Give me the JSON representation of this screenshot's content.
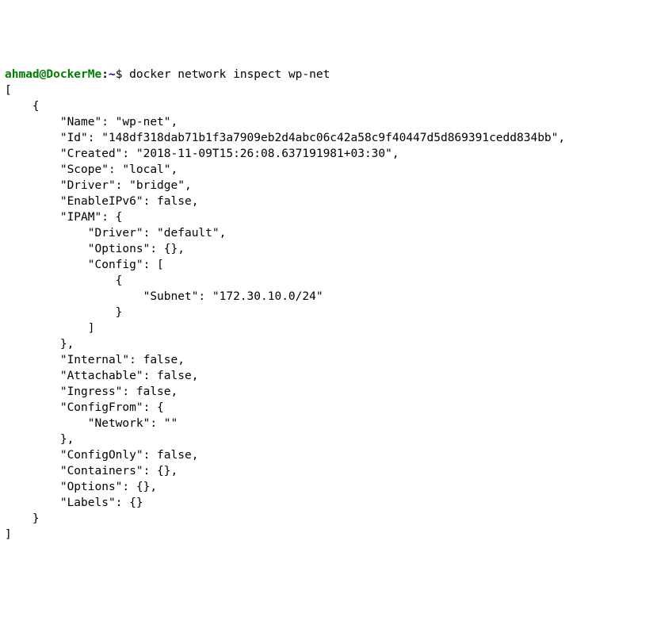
{
  "prompt": {
    "user": "ahmad",
    "at": "@",
    "host": "DockerMe",
    "colon": ":",
    "path": "~",
    "dollar": "$ "
  },
  "command": "docker network inspect wp-net",
  "output": "[\n    {\n        \"Name\": \"wp-net\",\n        \"Id\": \"148df318dab71b1f3a7909eb2d4abc06c42a58c9f40447d5d869391cedd834bb\",\n        \"Created\": \"2018-11-09T15:26:08.637191981+03:30\",\n        \"Scope\": \"local\",\n        \"Driver\": \"bridge\",\n        \"EnableIPv6\": false,\n        \"IPAM\": {\n            \"Driver\": \"default\",\n            \"Options\": {},\n            \"Config\": [\n                {\n                    \"Subnet\": \"172.30.10.0/24\"\n                }\n            ]\n        },\n        \"Internal\": false,\n        \"Attachable\": false,\n        \"Ingress\": false,\n        \"ConfigFrom\": {\n            \"Network\": \"\"\n        },\n        \"ConfigOnly\": false,\n        \"Containers\": {},\n        \"Options\": {},\n        \"Labels\": {}\n    }\n]"
}
